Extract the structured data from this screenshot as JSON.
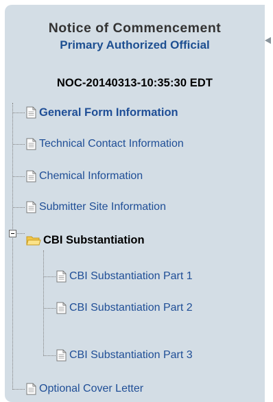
{
  "header": {
    "title": "Notice of Commencement",
    "subtitle": "Primary Authorized Official",
    "noc_id": "NOC-20140313-10:35:30 EDT"
  },
  "tree": {
    "items": [
      {
        "label": "General Form Information",
        "icon": "document-icon",
        "active": true
      },
      {
        "label": "Technical Contact Information",
        "icon": "document-icon"
      },
      {
        "label": "Chemical Information",
        "icon": "document-icon"
      },
      {
        "label": "Submitter Site Information",
        "icon": "document-icon"
      },
      {
        "label": "CBI Substantiation",
        "icon": "folder-open-icon",
        "expanded": true,
        "children": [
          {
            "label": "CBI Substantiation Part 1",
            "icon": "document-icon"
          },
          {
            "label": "CBI Substantiation Part 2",
            "icon": "document-icon"
          },
          {
            "label": "CBI Substantiation Part 3",
            "icon": "document-icon"
          }
        ]
      },
      {
        "label": "Optional Cover Letter",
        "icon": "document-icon"
      }
    ]
  },
  "colors": {
    "panel_bg": "#d3dde5",
    "link": "#1f4e96",
    "subtitle": "#1d4f91"
  }
}
